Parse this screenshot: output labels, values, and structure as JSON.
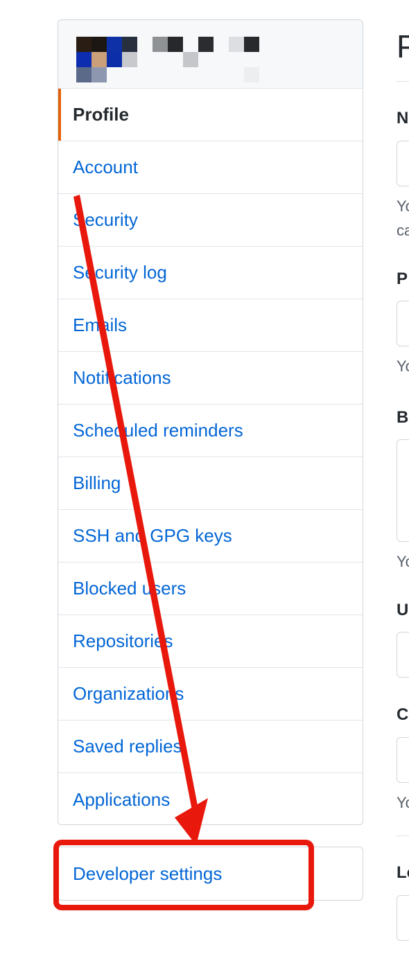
{
  "settings_menu": {
    "items": [
      {
        "label": "Profile",
        "selected": true
      },
      {
        "label": "Account"
      },
      {
        "label": "Security"
      },
      {
        "label": "Security log"
      },
      {
        "label": "Emails"
      },
      {
        "label": "Notifications"
      },
      {
        "label": "Scheduled reminders"
      },
      {
        "label": "Billing"
      },
      {
        "label": "SSH and GPG keys"
      },
      {
        "label": "Blocked users"
      },
      {
        "label": "Repositories"
      },
      {
        "label": "Organizations"
      },
      {
        "label": "Saved replies"
      },
      {
        "label": "Applications"
      }
    ]
  },
  "developer_menu": {
    "label": "Developer settings"
  },
  "profile_form": {
    "title": "P",
    "labels": [
      "N",
      "P",
      "B",
      "U",
      "C",
      "Lo"
    ],
    "notes": [
      "Yo",
      "ca",
      "Yo",
      "Yo",
      "Yo"
    ]
  },
  "annotation": {
    "color": "#e8180c",
    "arrow": "arrow-icon",
    "highlight": "highlight-box"
  },
  "colors": {
    "link": "#0366d6",
    "selected_accent": "#e36209",
    "text": "#24292e",
    "border": "#d1d5da"
  }
}
